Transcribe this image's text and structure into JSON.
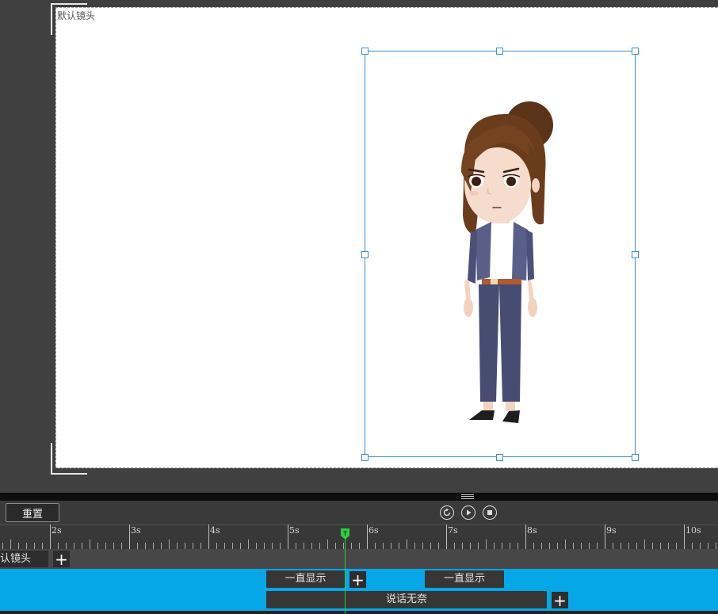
{
  "stage": {
    "camera_label": "默认镜头"
  },
  "controls": {
    "reset_label": "重置"
  },
  "ruler": {
    "labels": [
      "2s",
      "3s",
      "4s",
      "5s",
      "6s",
      "7s",
      "8s",
      "9s",
      "10s"
    ]
  },
  "tracks": {
    "camera_name": "默认镜头",
    "clips": {
      "always_show_1": "一直显示",
      "always_show_2": "一直显示",
      "speech": "说话无奈"
    }
  },
  "colors": {
    "selection": "#3a8fd9",
    "role_track": "#06a7e6",
    "playhead": "#2ecc40"
  }
}
